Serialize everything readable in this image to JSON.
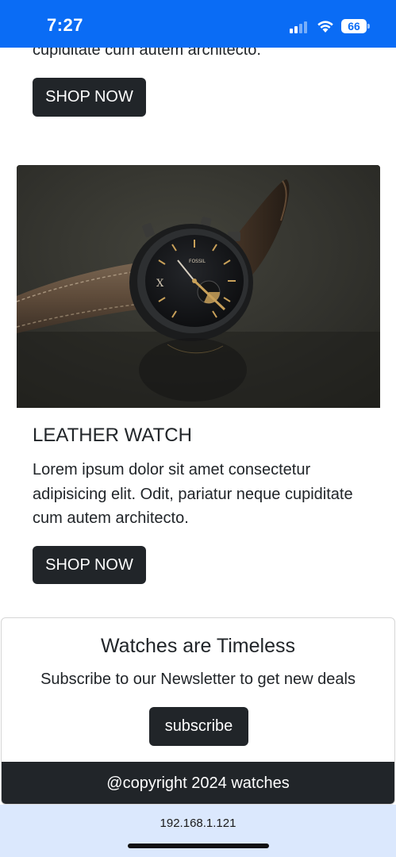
{
  "status_bar": {
    "time": "7:27",
    "battery_level": "66",
    "background_color": "#0a6cf5"
  },
  "previous_card": {
    "text_tail": "cupiditate cum autem architecto.",
    "shop_button_label": "SHOP NOW"
  },
  "product_card": {
    "image_icon": "leather-watch-photo",
    "title": "LEATHER WATCH",
    "description": "Lorem ipsum dolor sit amet consectetur adipisicing elit. Odit, pariatur neque cupiditate cum autem architecto.",
    "shop_button_label": "SHOP NOW"
  },
  "newsletter": {
    "title": "Watches are Timeless",
    "text": "Subscribe to our Newsletter to get new deals",
    "subscribe_label": "subscribe"
  },
  "footer": {
    "copyright": "@copyright 2024 watches",
    "background_color": "#212529"
  },
  "browser": {
    "url": "192.168.1.121"
  },
  "colors": {
    "button": "#212529",
    "text": "#212529"
  }
}
